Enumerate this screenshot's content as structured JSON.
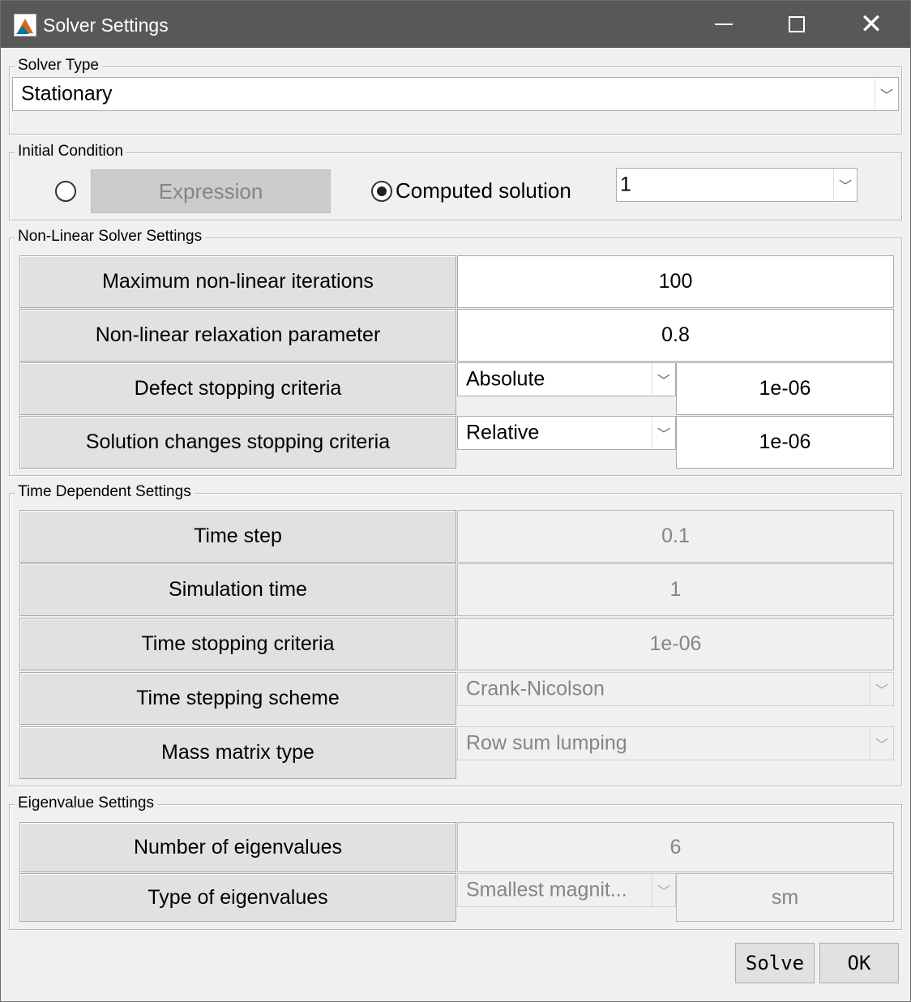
{
  "window": {
    "title": "Solver Settings"
  },
  "solver_type": {
    "legend": "Solver Type",
    "selected": "Stationary"
  },
  "initial_condition": {
    "legend": "Initial Condition",
    "expression_label": "Expression",
    "computed_label": "Computed solution",
    "computed_selected": "1"
  },
  "nonlinear": {
    "legend": "Non-Linear Solver Settings",
    "rows": [
      {
        "label": "Maximum non-linear iterations",
        "value": "100"
      },
      {
        "label": "Non-linear relaxation parameter",
        "value": "0.8"
      },
      {
        "label": "Defect stopping criteria",
        "mode": "Absolute",
        "value": "1e-06"
      },
      {
        "label": "Solution changes stopping criteria",
        "mode": "Relative",
        "value": "1e-06"
      }
    ]
  },
  "time_dependent": {
    "legend": "Time Dependent Settings",
    "rows": [
      {
        "label": "Time step",
        "value": "0.1"
      },
      {
        "label": "Simulation time",
        "value": "1"
      },
      {
        "label": "Time stopping criteria",
        "value": "1e-06"
      },
      {
        "label": "Time stepping scheme",
        "value": "Crank-Nicolson"
      },
      {
        "label": "Mass matrix type",
        "value": "Row sum lumping"
      }
    ]
  },
  "eigenvalue": {
    "legend": "Eigenvalue Settings",
    "rows": [
      {
        "label": "Number of eigenvalues",
        "value": "6"
      },
      {
        "label": "Type of eigenvalues",
        "mode": "Smallest magnit...",
        "value": "sm"
      }
    ]
  },
  "buttons": {
    "solve": "Solve",
    "ok": "OK"
  }
}
